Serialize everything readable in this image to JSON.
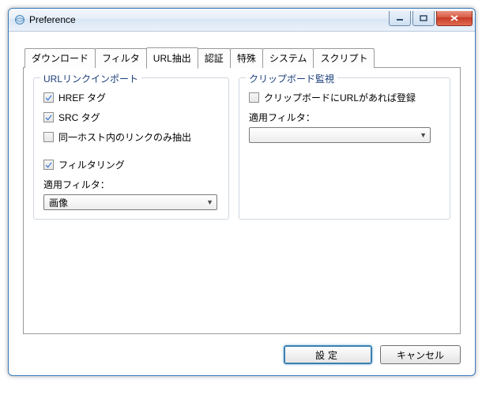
{
  "window": {
    "title": "Preference"
  },
  "tabs": [
    {
      "label": "ダウンロード"
    },
    {
      "label": "フィルタ"
    },
    {
      "label": "URL抽出"
    },
    {
      "label": "認証"
    },
    {
      "label": "特殊"
    },
    {
      "label": "システム"
    },
    {
      "label": "スクリプト"
    }
  ],
  "active_tab": 2,
  "group_left": {
    "title": "URLリンクインポート",
    "check_href": {
      "label": "HREF タグ",
      "checked": true
    },
    "check_src": {
      "label": "SRC タグ",
      "checked": true
    },
    "check_samehost": {
      "label": "同一ホスト内のリンクのみ抽出",
      "checked": false
    },
    "check_filtering": {
      "label": "フィルタリング",
      "checked": true
    },
    "filter_label": "適用フィルタ：",
    "filter_value": "画像"
  },
  "group_right": {
    "title": "クリップボード監視",
    "check_clip": {
      "label": "クリップボードにURLがあれば登録",
      "checked": false
    },
    "filter_label": "適用フィルタ：",
    "filter_value": ""
  },
  "buttons": {
    "ok": "設定",
    "cancel": "キャンセル"
  }
}
